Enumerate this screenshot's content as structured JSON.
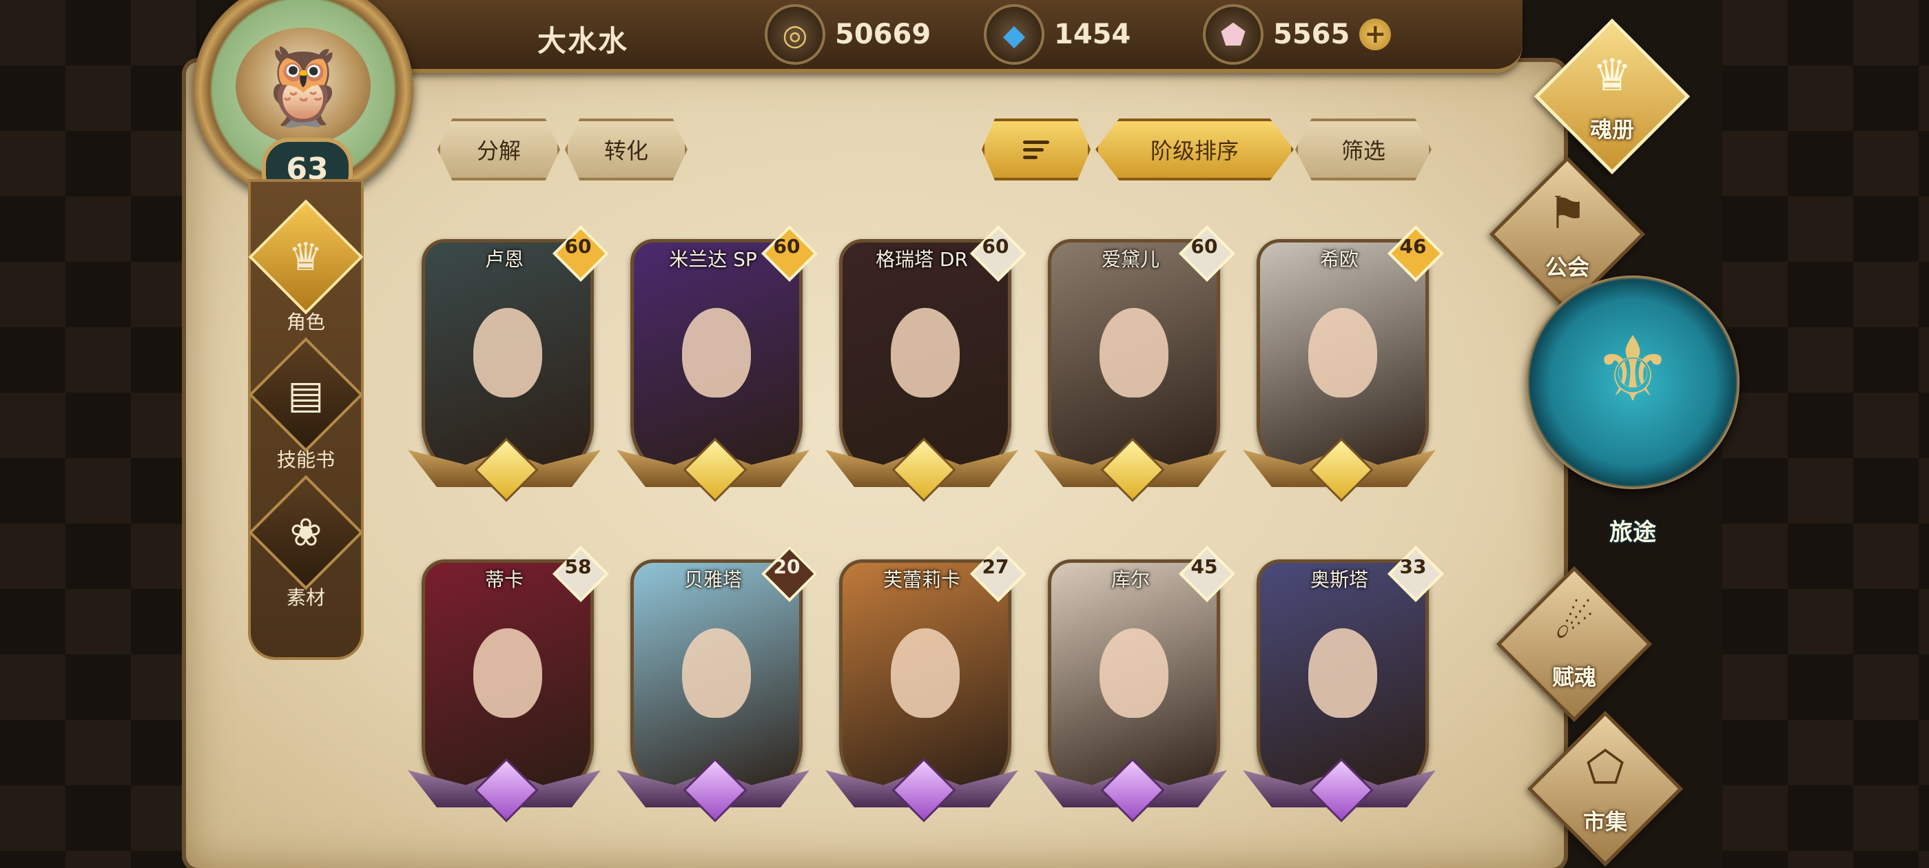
{
  "player": {
    "name": "大水水",
    "level": "63"
  },
  "resources": [
    {
      "icon": "gold-coin-icon",
      "value": "50669"
    },
    {
      "icon": "blue-crystal-icon",
      "value": "1454"
    },
    {
      "icon": "pink-gem-icon",
      "value": "5565"
    }
  ],
  "left_nav": [
    {
      "label": "角色",
      "icon": "character-icon",
      "active": true
    },
    {
      "label": "技能书",
      "icon": "skill-book-icon",
      "active": false
    },
    {
      "label": "素材",
      "icon": "material-icon",
      "active": false
    }
  ],
  "toolbar": {
    "decompose": "分解",
    "convert": "转化",
    "sort_order": "sort-order-icon",
    "rank_sort": "阶级排序",
    "filter": "筛选"
  },
  "cards": [
    {
      "name": "卢恩",
      "level": "60",
      "tier": "gold",
      "badge_color": "#f0b73a",
      "portrait_color": "#3b4a4a"
    },
    {
      "name": "米兰达 SP",
      "level": "60",
      "tier": "gold",
      "badge_color": "#f0b73a",
      "portrait_color": "#4b2a6e"
    },
    {
      "name": "格瑞塔 DR",
      "level": "60",
      "tier": "gold",
      "badge_color": "#e9e2d2",
      "portrait_color": "#3a2424"
    },
    {
      "name": "爱黛儿",
      "level": "60",
      "tier": "gold",
      "badge_color": "#e9e2d2",
      "portrait_color": "#8a7a6a"
    },
    {
      "name": "希欧",
      "level": "46",
      "tier": "gold",
      "badge_color": "#f0b73a",
      "portrait_color": "#c9c2b8"
    },
    {
      "name": "蒂卡",
      "level": "58",
      "tier": "purple",
      "badge_color": "#e9e2d2",
      "portrait_color": "#7a1e2e"
    },
    {
      "name": "贝雅塔",
      "level": "20",
      "tier": "purple",
      "badge_color": "#5a3220",
      "portrait_color": "#8fc3d6"
    },
    {
      "name": "芙蕾莉卡",
      "level": "27",
      "tier": "purple",
      "badge_color": "#e9e2d2",
      "portrait_color": "#c07a3a"
    },
    {
      "name": "库尔",
      "level": "45",
      "tier": "purple",
      "badge_color": "#e9e2d2",
      "portrait_color": "#d8c9b8"
    },
    {
      "name": "奥斯塔",
      "level": "33",
      "tier": "purple",
      "badge_color": "#e9e2d2",
      "portrait_color": "#4a4a7a"
    }
  ],
  "right_nav": [
    {
      "label": "魂册",
      "icon": "soul-book-icon",
      "active": true
    },
    {
      "label": "公会",
      "icon": "guild-icon",
      "active": false
    },
    {
      "label": "旅途",
      "icon": "journey-icon",
      "active": false
    },
    {
      "label": "赋魂",
      "icon": "soul-infuse-icon",
      "active": false
    },
    {
      "label": "市集",
      "icon": "market-icon",
      "active": false
    }
  ]
}
